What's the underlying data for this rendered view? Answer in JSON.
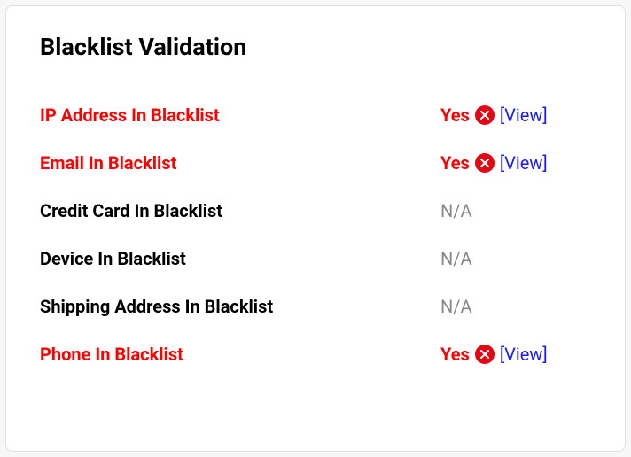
{
  "title": "Blacklist Validation",
  "viewLabel": "[View]",
  "rows": [
    {
      "label": "IP Address In Blacklist",
      "value": "Yes",
      "status": "danger"
    },
    {
      "label": "Email In Blacklist",
      "value": "Yes",
      "status": "danger"
    },
    {
      "label": "Credit Card In Blacklist",
      "value": "N/A",
      "status": "na"
    },
    {
      "label": "Device In Blacklist",
      "value": "N/A",
      "status": "na"
    },
    {
      "label": "Shipping Address In Blacklist",
      "value": "N/A",
      "status": "na"
    },
    {
      "label": "Phone In Blacklist",
      "value": "Yes",
      "status": "danger"
    }
  ]
}
